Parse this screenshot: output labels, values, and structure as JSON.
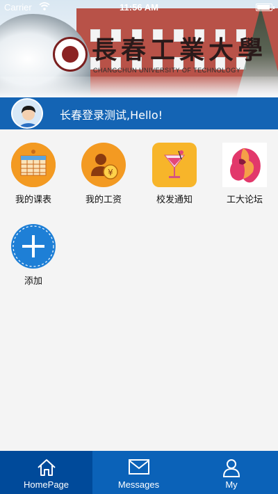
{
  "status_bar": {
    "carrier": "Carrier",
    "time": "11:56 AM",
    "wifi_icon": "wifi-icon",
    "battery_icon": "battery-icon"
  },
  "banner": {
    "logo_title": "長春工業大學",
    "logo_subtitle": "CHANGCHUN UNIVERSITY OF TECHNOLOGY"
  },
  "greeting": {
    "text": "长春登录测试,Hello!",
    "avatar_icon": "user-avatar-icon"
  },
  "apps": [
    {
      "label": "我的课表",
      "icon": "timetable-icon",
      "color": "#f39a22"
    },
    {
      "label": "我的工资",
      "icon": "salary-icon",
      "color": "#f39a22"
    },
    {
      "label": "校发通知",
      "icon": "notice-cocktail-icon",
      "color": "#f7b52a"
    },
    {
      "label": "工大论坛",
      "icon": "forum-lion-icon",
      "color": "#e2386b"
    },
    {
      "label": "添加",
      "icon": "add-icon",
      "color": "#1e7fd6"
    }
  ],
  "tabs": [
    {
      "label": "HomePage",
      "icon": "home-icon",
      "active": true
    },
    {
      "label": "Messages",
      "icon": "mail-icon",
      "active": false
    },
    {
      "label": "My",
      "icon": "person-icon",
      "active": false
    }
  ],
  "colors": {
    "primary_blue": "#1464b4",
    "tab_active": "#004a9a",
    "tab_bg": "#0b62b8"
  }
}
